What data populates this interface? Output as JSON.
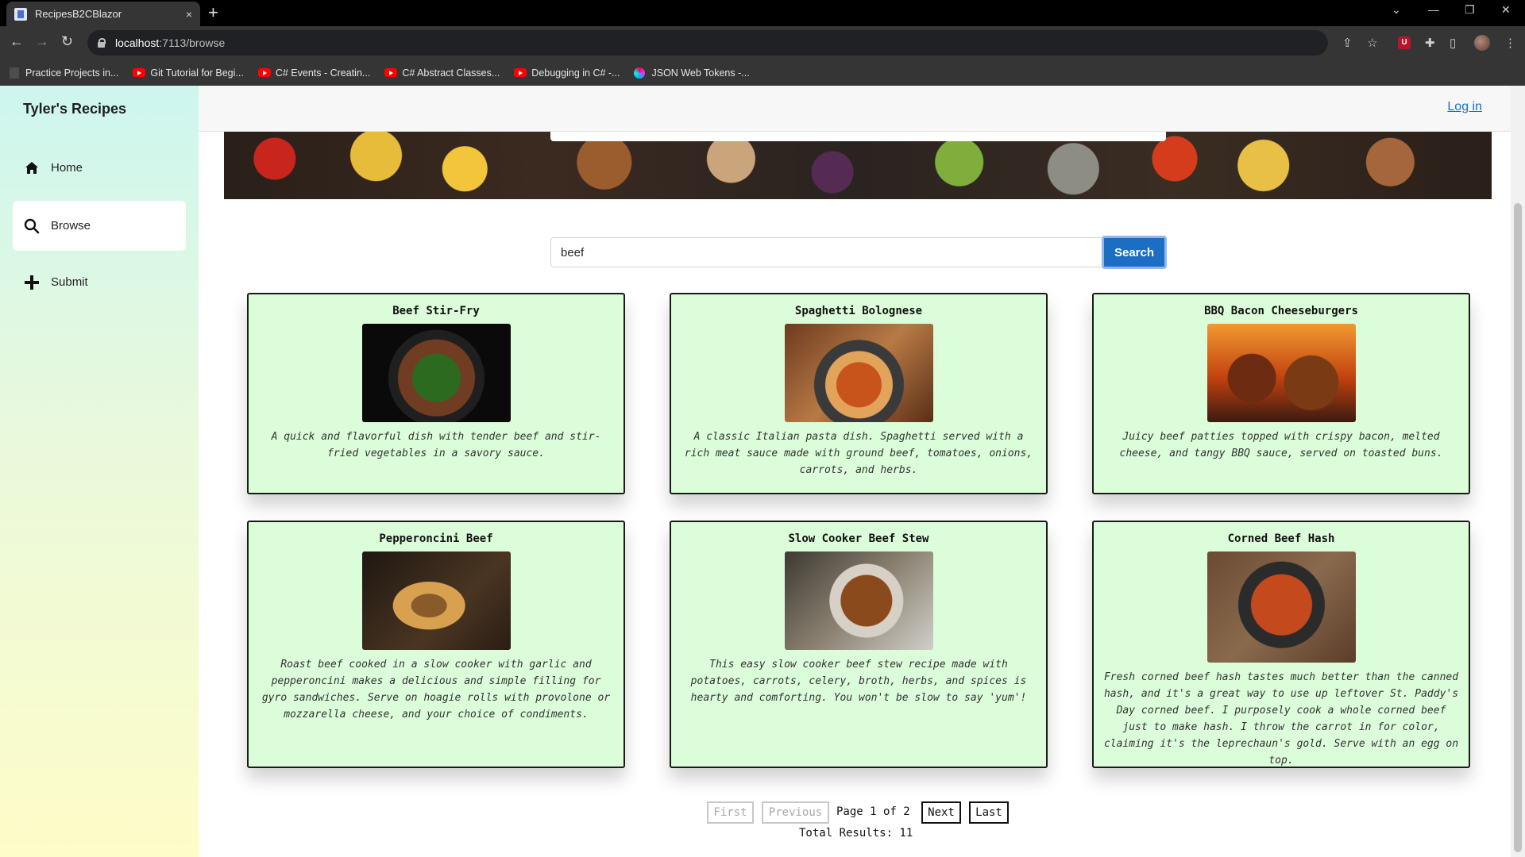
{
  "browser": {
    "tab_title": "RecipesB2CBlazor",
    "tab_close": "×",
    "new_tab": "+",
    "url_host": "localhost",
    "url_rest": ":7113/browse",
    "bookmarks": [
      {
        "label": "Practice Projects in...",
        "icon": "doc"
      },
      {
        "label": "Git Tutorial for Begi...",
        "icon": "youtube"
      },
      {
        "label": "C# Events - Creatin...",
        "icon": "youtube"
      },
      {
        "label": "C# Abstract Classes...",
        "icon": "youtube"
      },
      {
        "label": "Debugging in C# -...",
        "icon": "youtube"
      },
      {
        "label": "JSON Web Tokens -...",
        "icon": "jwt"
      }
    ]
  },
  "app": {
    "brand": "Tyler's Recipes",
    "login": "Log in",
    "nav": [
      {
        "label": "Home",
        "icon": "home-icon",
        "glyph": "⌂"
      },
      {
        "label": "Browse",
        "icon": "search-icon",
        "glyph": "⌕"
      },
      {
        "label": "Submit",
        "icon": "plus-icon",
        "glyph": "+"
      }
    ],
    "active_nav": "Browse"
  },
  "search": {
    "value": "beef",
    "button_label": "Search"
  },
  "recipes": [
    {
      "title": "Beef Stir-Fry",
      "image": "stir-fry-photo",
      "description": "A quick and flavorful dish with tender beef and stir-fried vegetables in a savory sauce."
    },
    {
      "title": "Spaghetti Bolognese",
      "image": "spaghetti-photo",
      "description": "A classic Italian pasta dish. Spaghetti served with a rich meat sauce made with ground beef, tomatoes, onions, carrots, and herbs."
    },
    {
      "title": "BBQ Bacon Cheeseburgers",
      "image": "cheeseburger-photo",
      "description": "Juicy beef patties topped with crispy bacon, melted cheese, and tangy BBQ sauce, served on toasted buns."
    },
    {
      "title": "Pepperoncini Beef",
      "image": "pepperoncini-sandwich-photo",
      "description": "Roast beef cooked in a slow cooker with garlic and pepperoncini makes a delicious and simple filling for gyro sandwiches. Serve on hoagie rolls with provolone or mozzarella cheese, and your choice of condiments."
    },
    {
      "title": "Slow Cooker Beef Stew",
      "image": "beef-stew-photo",
      "description": "This easy slow cooker beef stew recipe made with potatoes, carrots, celery, broth, herbs, and spices is hearty and comforting. You won't be slow to say 'yum'!"
    },
    {
      "title": "Corned Beef Hash",
      "image": "corned-beef-hash-photo",
      "description": "Fresh corned beef hash tastes much better than the canned hash, and it's a great way to use up leftover St. Paddy's Day corned beef. I purposely cook a whole corned beef just to make hash. I throw the carrot in for color, claiming it's the leprechaun's gold. Serve with an egg on top."
    }
  ],
  "pagination": {
    "first": "First",
    "previous": "Previous",
    "info": "Page 1 of 2",
    "next": "Next",
    "last": "Last",
    "total": "Total Results: 11"
  }
}
